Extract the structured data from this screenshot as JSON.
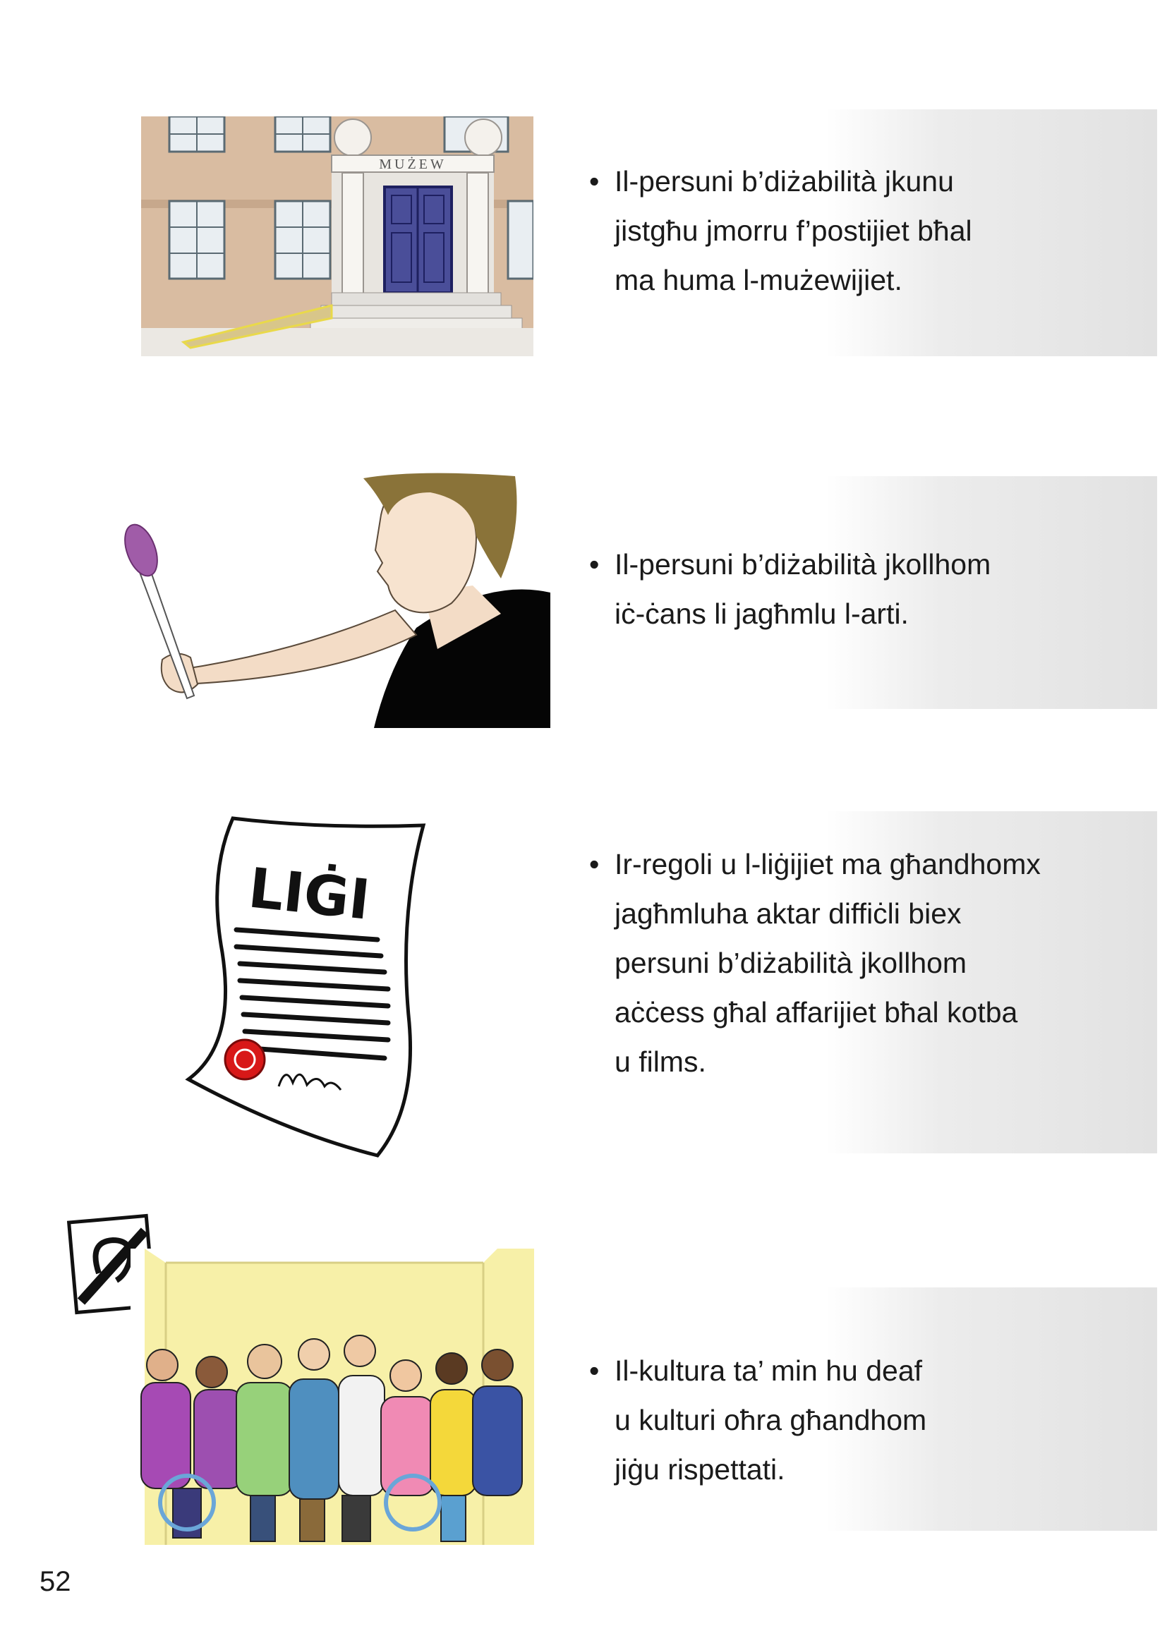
{
  "page_number": "52",
  "sections": [
    {
      "bullet_lines": [
        "Il-persuni b’diżabilità jkunu",
        "jistgħu jmorru f’postijiet bħal",
        "ma huma l-mużewijiet."
      ],
      "image": {
        "sign_text": "MUŻEW"
      }
    },
    {
      "bullet_lines": [
        "Il-persuni b’diżabilità jkollhom",
        "iċ-ċans li jagħmlu l-arti."
      ]
    },
    {
      "bullet_lines": [
        "Ir-regoli u l-liġijiet ma għandhomx",
        "jagħmluha aktar diffiċli biex",
        "persuni b’diżabilità jkollhom",
        "aċċess għal affarijiet bħal kotba",
        "u films."
      ],
      "image": {
        "document_title": "LIĠI"
      }
    },
    {
      "bullet_lines": [
        "Il-kultura ta’ min hu deaf",
        "u kulturi oħra għandhom",
        "jiġu rispettati."
      ]
    }
  ]
}
